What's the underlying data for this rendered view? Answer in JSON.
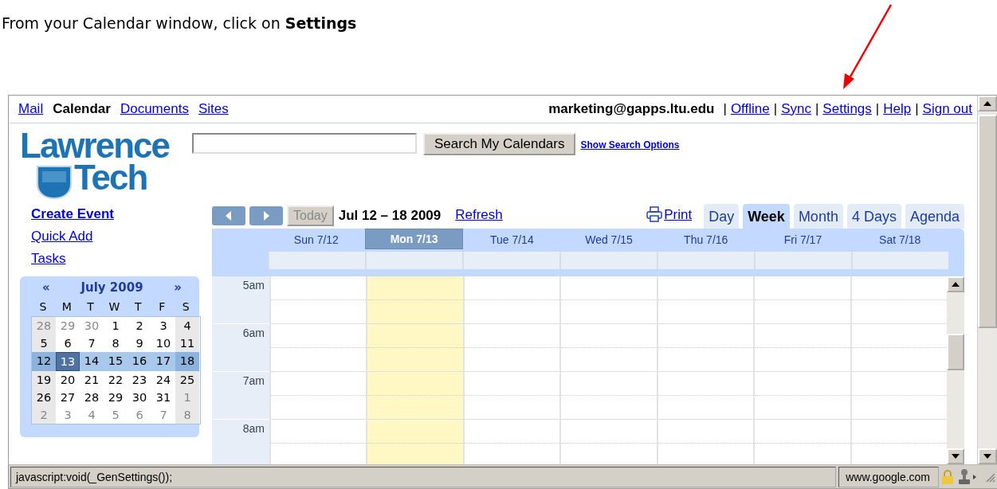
{
  "instruction": "From your Calendar window, click on **Settings**",
  "nav": {
    "apps": [
      {
        "label": "Mail",
        "selected": false
      },
      {
        "label": "Calendar",
        "selected": true
      },
      {
        "label": "Documents",
        "selected": false
      },
      {
        "label": "Sites",
        "selected": false
      }
    ],
    "account": "marketing@gapps.ltu.edu",
    "separator": "|",
    "links": [
      "Offline",
      "Sync",
      "Settings",
      "Help",
      "Sign out"
    ]
  },
  "logo": {
    "line_1": "Lawrence",
    "line_2": "Tech"
  },
  "search": {
    "button": "Search My Calendars",
    "options_link": "Show Search Options"
  },
  "sidebar": {
    "create": "Create Event",
    "links": [
      "Quick Add",
      "Tasks"
    ]
  },
  "mini_calendar": {
    "prev": "«",
    "title": "July 2009",
    "next": "»",
    "weekdays": [
      "S",
      "M",
      "T",
      "W",
      "T",
      "F",
      "S"
    ],
    "weeks": [
      {
        "selected": false,
        "days": [
          {
            "label": "28",
            "other_month": true,
            "today": false
          },
          {
            "label": "29",
            "other_month": true,
            "today": false
          },
          {
            "label": "30",
            "other_month": true,
            "today": false
          },
          {
            "label": "1",
            "other_month": false,
            "today": false
          },
          {
            "label": "2",
            "other_month": false,
            "today": false
          },
          {
            "label": "3",
            "other_month": false,
            "today": false
          },
          {
            "label": "4",
            "other_month": false,
            "today": false
          }
        ]
      },
      {
        "selected": false,
        "days": [
          {
            "label": "5",
            "other_month": false,
            "today": false
          },
          {
            "label": "6",
            "other_month": false,
            "today": false
          },
          {
            "label": "7",
            "other_month": false,
            "today": false
          },
          {
            "label": "8",
            "other_month": false,
            "today": false
          },
          {
            "label": "9",
            "other_month": false,
            "today": false
          },
          {
            "label": "10",
            "other_month": false,
            "today": false
          },
          {
            "label": "11",
            "other_month": false,
            "today": false
          }
        ]
      },
      {
        "selected": true,
        "days": [
          {
            "label": "12",
            "other_month": false,
            "today": false
          },
          {
            "label": "13",
            "other_month": false,
            "today": true
          },
          {
            "label": "14",
            "other_month": false,
            "today": false
          },
          {
            "label": "15",
            "other_month": false,
            "today": false
          },
          {
            "label": "16",
            "other_month": false,
            "today": false
          },
          {
            "label": "17",
            "other_month": false,
            "today": false
          },
          {
            "label": "18",
            "other_month": false,
            "today": false
          }
        ]
      },
      {
        "selected": false,
        "days": [
          {
            "label": "19",
            "other_month": false,
            "today": false
          },
          {
            "label": "20",
            "other_month": false,
            "today": false
          },
          {
            "label": "21",
            "other_month": false,
            "today": false
          },
          {
            "label": "22",
            "other_month": false,
            "today": false
          },
          {
            "label": "23",
            "other_month": false,
            "today": false
          },
          {
            "label": "24",
            "other_month": false,
            "today": false
          },
          {
            "label": "25",
            "other_month": false,
            "today": false
          }
        ]
      },
      {
        "selected": false,
        "days": [
          {
            "label": "26",
            "other_month": false,
            "today": false
          },
          {
            "label": "27",
            "other_month": false,
            "today": false
          },
          {
            "label": "28",
            "other_month": false,
            "today": false
          },
          {
            "label": "29",
            "other_month": false,
            "today": false
          },
          {
            "label": "30",
            "other_month": false,
            "today": false
          },
          {
            "label": "31",
            "other_month": false,
            "today": false
          },
          {
            "label": "1",
            "other_month": true,
            "today": false
          }
        ]
      },
      {
        "selected": false,
        "days": [
          {
            "label": "2",
            "other_month": true,
            "today": false
          },
          {
            "label": "3",
            "other_month": true,
            "today": false
          },
          {
            "label": "4",
            "other_month": true,
            "today": false
          },
          {
            "label": "5",
            "other_month": true,
            "today": false
          },
          {
            "label": "6",
            "other_month": true,
            "today": false
          },
          {
            "label": "7",
            "other_month": true,
            "today": false
          },
          {
            "label": "8",
            "other_month": true,
            "today": false
          }
        ]
      }
    ]
  },
  "toolbar": {
    "today": "Today",
    "today_disabled": true,
    "range": "Jul 12 – 18 2009",
    "refresh": "Refresh",
    "print": "Print",
    "tabs": [
      {
        "label": "Day",
        "selected": false
      },
      {
        "label": "Week",
        "selected": true
      },
      {
        "label": "Month",
        "selected": false
      },
      {
        "label": "4 Days",
        "selected": false
      },
      {
        "label": "Agenda",
        "selected": false
      }
    ]
  },
  "week": {
    "days": [
      {
        "label": "Sun 7/12",
        "selected": false
      },
      {
        "label": "Mon 7/13",
        "selected": true
      },
      {
        "label": "Tue 7/14",
        "selected": false
      },
      {
        "label": "Wed 7/15",
        "selected": false
      },
      {
        "label": "Thu 7/16",
        "selected": false
      },
      {
        "label": "Fri 7/17",
        "selected": false
      },
      {
        "label": "Sat 7/18",
        "selected": false
      }
    ],
    "hours": [
      "5am",
      "6am",
      "7am",
      "8am"
    ]
  },
  "status_bar": {
    "text": "javascript:void(_GenSettings());",
    "zone": "www.google.com"
  }
}
